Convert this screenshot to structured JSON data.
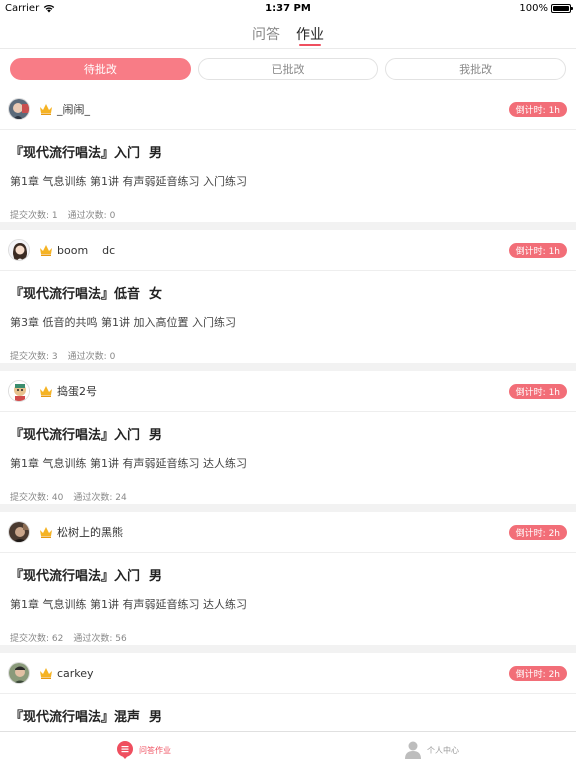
{
  "status_bar": {
    "carrier": "Carrier",
    "time": "1:37 PM",
    "battery": "100%"
  },
  "top_tabs": [
    {
      "label": "问答",
      "active": false
    },
    {
      "label": "作业",
      "active": true
    }
  ],
  "segments": [
    {
      "label": "待批改",
      "active": true
    },
    {
      "label": "已批改",
      "active": false
    },
    {
      "label": "我批改",
      "active": false
    }
  ],
  "stats_labels": {
    "submit": "提交次数:",
    "pass": "通过次数:"
  },
  "cards": [
    {
      "username": "_闹闹_",
      "countdown": "倒计时: 1h",
      "title": "『现代流行唱法』入门  男",
      "subtitle": "第1章 气息训练 第1讲 有声弱延音练习 入门练习",
      "submit_count": "1",
      "pass_count": "0"
    },
    {
      "username": "boom    dc",
      "countdown": "倒计时: 1h",
      "title": "『现代流行唱法』低音  女",
      "subtitle": "第3章 低音的共鸣 第1讲 加入高位置 入门练习",
      "submit_count": "3",
      "pass_count": "0"
    },
    {
      "username": "捣蛋2号",
      "countdown": "倒计时: 1h",
      "title": "『现代流行唱法』入门  男",
      "subtitle": "第1章 气息训练 第1讲 有声弱延音练习 达人练习",
      "submit_count": "40",
      "pass_count": "24"
    },
    {
      "username": "松树上的黑熊",
      "countdown": "倒计时: 2h",
      "title": "『现代流行唱法』入门  男",
      "subtitle": "第1章 气息训练 第1讲 有声弱延音练习 达人练习",
      "submit_count": "62",
      "pass_count": "56"
    },
    {
      "username": "carkey",
      "countdown": "倒计时: 2h",
      "title": "『现代流行唱法』混声  男",
      "subtitle": "",
      "submit_count": "",
      "pass_count": ""
    }
  ],
  "tab_bar": [
    {
      "label": "问答作业",
      "icon": "list-icon",
      "active": true
    },
    {
      "label": "个人中心",
      "icon": "person-icon",
      "active": false
    }
  ],
  "colors": {
    "accent": "#ef4f5f",
    "badge": "#f26e78",
    "segment_active": "#f87c86",
    "crown": "#f5b324"
  }
}
